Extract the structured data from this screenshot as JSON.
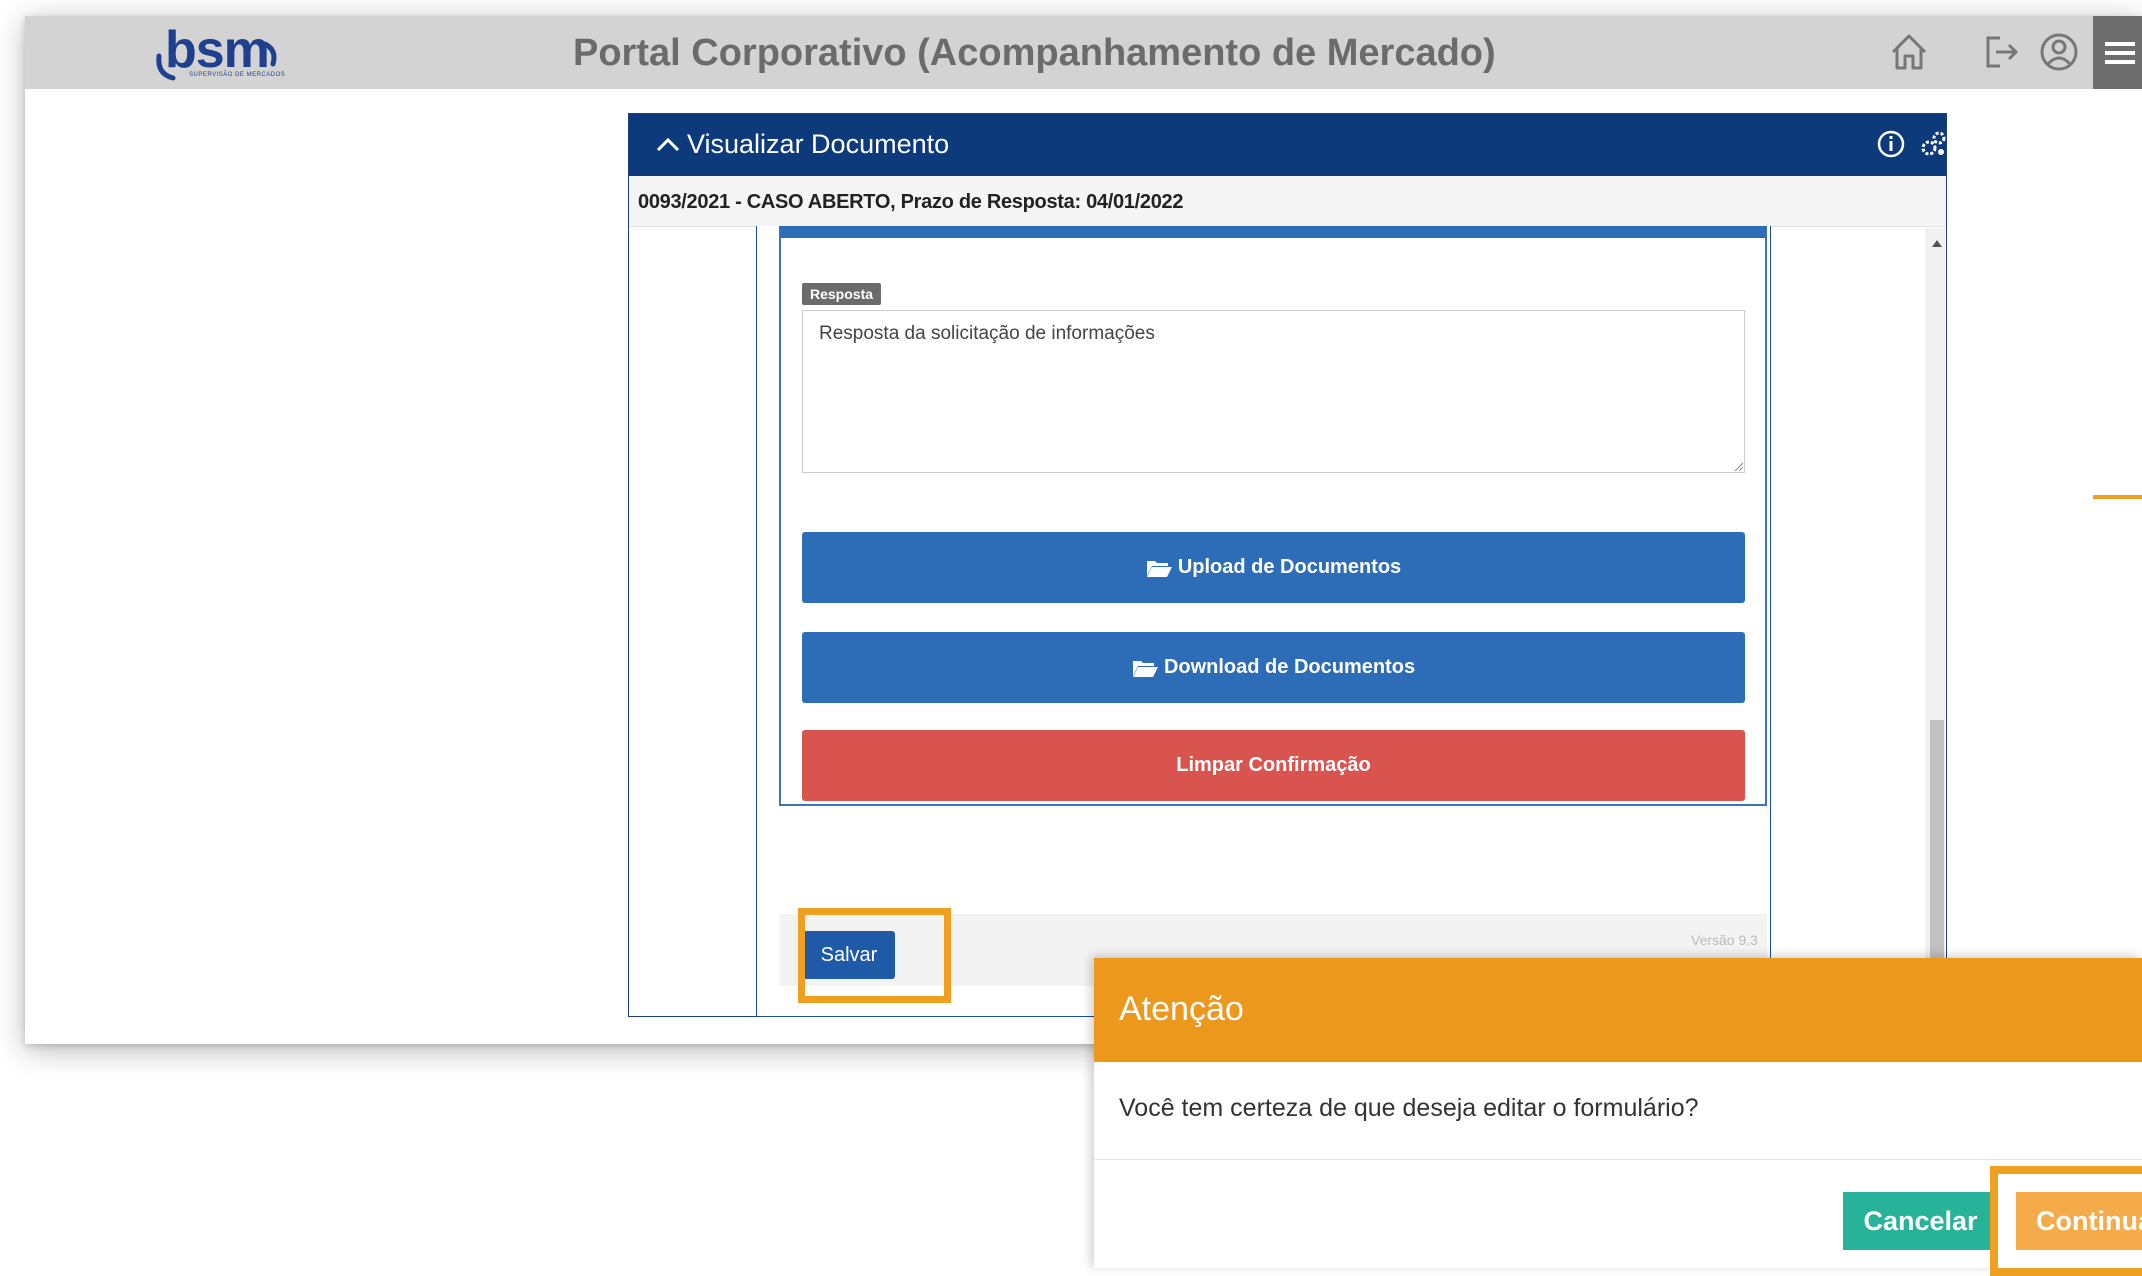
{
  "app": {
    "logo_text": "bsm",
    "logo_subtext": "SUPERVISÃO DE MERCADOS",
    "title": "Portal Corporativo (Acompanhamento de Mercado)"
  },
  "header_icons": [
    "home-icon",
    "logout-icon",
    "user-icon",
    "menu-icon"
  ],
  "panel": {
    "title": "Visualizar Documento",
    "case_info": "0093/2021 - CASO ABERTO, Prazo de Resposta: 04/01/2022",
    "icons": [
      "info-icon",
      "settings-icon"
    ]
  },
  "form": {
    "response_label": "Resposta",
    "response_value": "Resposta da solicitação de informações",
    "upload_label": "Upload de Documentos",
    "download_label": "Download de Documentos",
    "clear_label": "Limpar Confirmação",
    "save_label": "Salvar",
    "version_text": "Versão 9.3"
  },
  "modal": {
    "title": "Atenção",
    "message": "Você tem certeza de que deseja editar o formulário?",
    "cancel_label": "Cancelar",
    "continue_label": "Continuar"
  },
  "colors": {
    "header_bg": "#d3d3d3",
    "panel_header": "#0d3a7a",
    "primary_blue": "#2d6db7",
    "danger_red": "#d9534f",
    "modal_orange": "#ec981c",
    "highlight": "#f0a020",
    "cancel_teal": "#26b399"
  }
}
